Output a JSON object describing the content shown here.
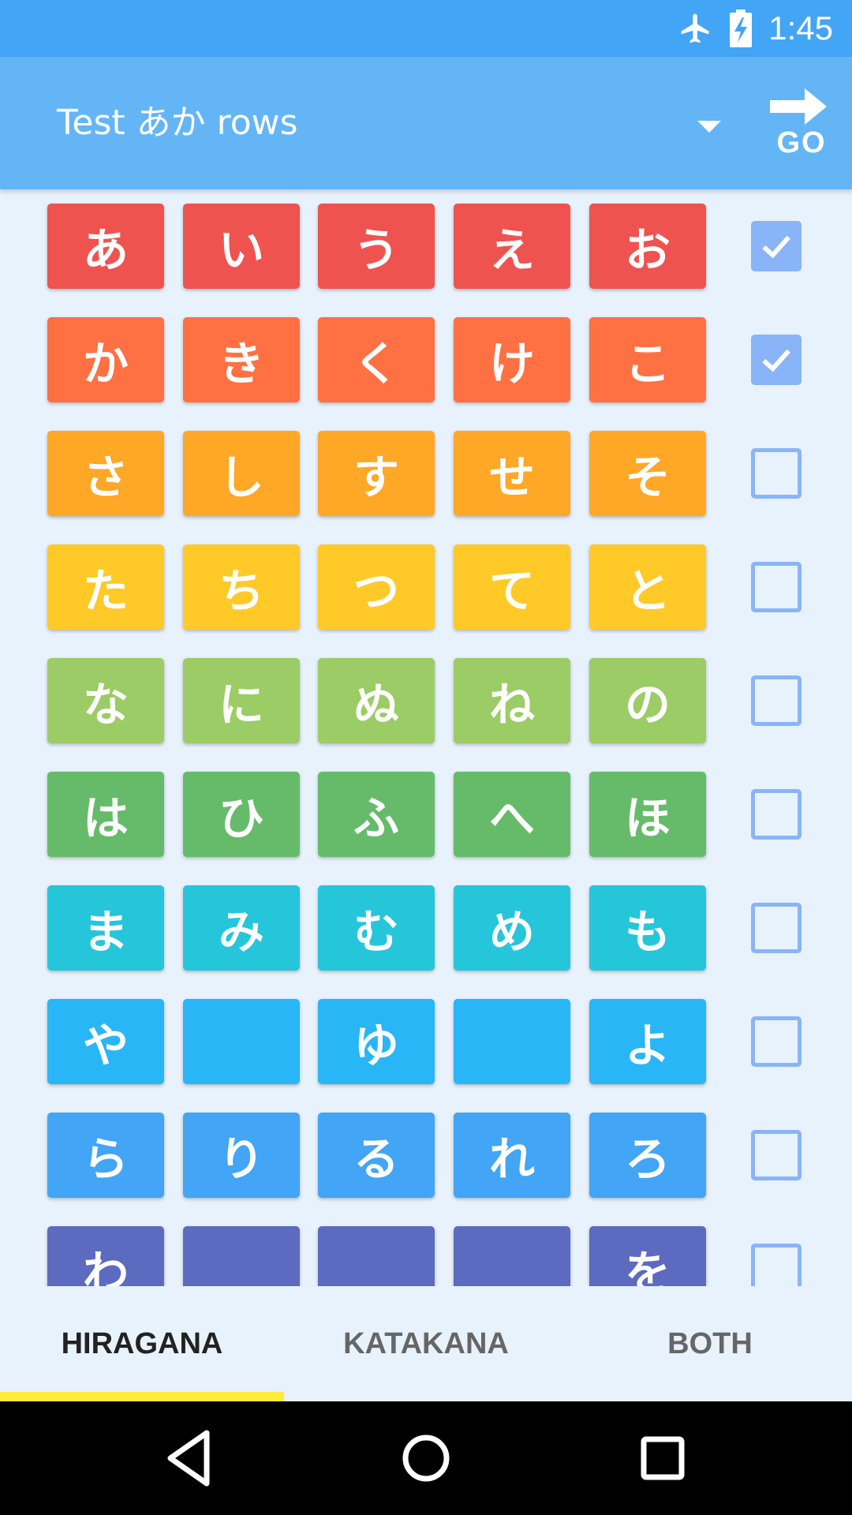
{
  "status_bar": {
    "time": "1:45",
    "icons": [
      "airplane-icon",
      "battery-charging-icon"
    ]
  },
  "app_bar": {
    "title": "Test あか rows",
    "go_label": "GO"
  },
  "rows": [
    {
      "color": "#EF5350",
      "kana": [
        "あ",
        "い",
        "う",
        "え",
        "お"
      ],
      "checked": true
    },
    {
      "color": "#FF7043",
      "kana": [
        "か",
        "き",
        "く",
        "け",
        "こ"
      ],
      "checked": true
    },
    {
      "color": "#FFA726",
      "kana": [
        "さ",
        "し",
        "す",
        "せ",
        "そ"
      ],
      "checked": false
    },
    {
      "color": "#FFCA28",
      "kana": [
        "た",
        "ち",
        "つ",
        "て",
        "と"
      ],
      "checked": false
    },
    {
      "color": "#9CCC65",
      "kana": [
        "な",
        "に",
        "ぬ",
        "ね",
        "の"
      ],
      "checked": false
    },
    {
      "color": "#66BB6A",
      "kana": [
        "は",
        "ひ",
        "ふ",
        "へ",
        "ほ"
      ],
      "checked": false
    },
    {
      "color": "#26C6DA",
      "kana": [
        "ま",
        "み",
        "む",
        "め",
        "も"
      ],
      "checked": false
    },
    {
      "color": "#29B6F6",
      "kana": [
        "や",
        "",
        "ゆ",
        "",
        "よ"
      ],
      "checked": false
    },
    {
      "color": "#42A5F5",
      "kana": [
        "ら",
        "り",
        "る",
        "れ",
        "ろ"
      ],
      "checked": false
    },
    {
      "color": "#5C6BC0",
      "kana": [
        "わ",
        "",
        "",
        "",
        "を"
      ],
      "checked": false
    }
  ],
  "tabs": [
    {
      "label": "HIRAGANA",
      "active": true
    },
    {
      "label": "KATAKANA",
      "active": false
    },
    {
      "label": "BOTH",
      "active": false
    }
  ],
  "colors": {
    "status_bar": "#42A5F5",
    "app_bar": "#64B5F6",
    "background": "#E8F2FC",
    "indicator": "#FFEB3B",
    "checkbox": "#8AB4F8"
  }
}
